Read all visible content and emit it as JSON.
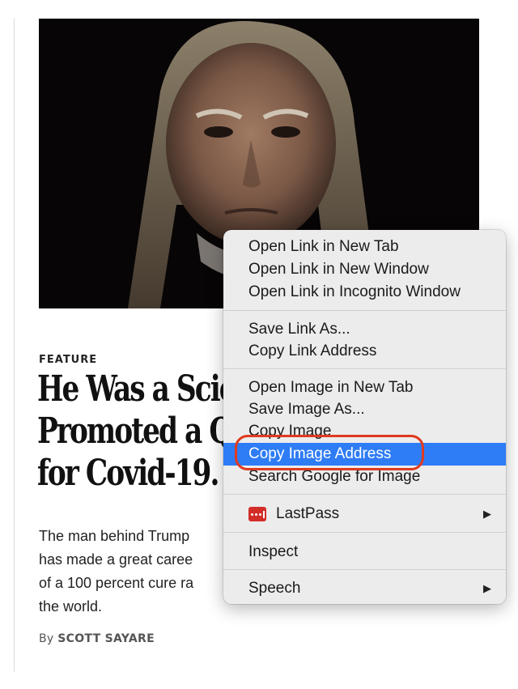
{
  "article": {
    "kicker": "FEATURE",
    "headline_lines": [
      "He Was a Scie",
      "Promoted a Q",
      "for Covid-19."
    ],
    "dek_lines": [
      "The man behind Trump",
      "has made a great caree",
      "of a 100 percent cure ra",
      "the world."
    ],
    "byline_prefix": "By",
    "byline_author": "SCOTT SAYARE"
  },
  "context_menu": {
    "items": [
      {
        "label": "Open Link in New Tab"
      },
      {
        "label": "Open Link in New Window"
      },
      {
        "label": "Open Link in Incognito Window"
      },
      {
        "label": "Save Link As..."
      },
      {
        "label": "Copy Link Address"
      },
      {
        "label": "Open Image in New Tab"
      },
      {
        "label": "Save Image As..."
      },
      {
        "label": "Copy Image"
      },
      {
        "label": "Copy Image Address",
        "highlighted": true
      },
      {
        "label": "Search Google for Image"
      },
      {
        "label": "LastPass",
        "icon": "lastpass-icon",
        "submenu": true
      },
      {
        "label": "Inspect"
      },
      {
        "label": "Speech",
        "submenu": true
      }
    ],
    "submenu_arrow": "▶",
    "highlight_color": "#2e7cf6"
  },
  "annotation": {
    "color": "#e03a1e",
    "target": "Copy Image Address"
  }
}
